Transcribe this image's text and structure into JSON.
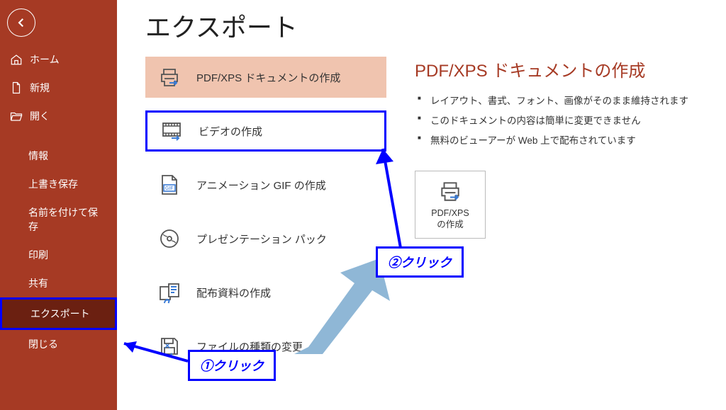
{
  "page_title": "エクスポート",
  "sidebar": {
    "back_label": "戻る",
    "items": [
      {
        "icon": "home",
        "label": "ホーム"
      },
      {
        "icon": "file",
        "label": "新規"
      },
      {
        "icon": "folder",
        "label": "開く"
      }
    ],
    "items2": [
      {
        "label": "情報"
      },
      {
        "label": "上書き保存"
      },
      {
        "label": "名前を付けて保存"
      },
      {
        "label": "印刷"
      },
      {
        "label": "共有"
      },
      {
        "label": "エクスポート",
        "selected": true
      },
      {
        "label": "閉じる"
      }
    ]
  },
  "export_options": [
    {
      "id": "pdfxps",
      "icon": "printer-arrow",
      "label": "PDF/XPS ドキュメントの作成",
      "selected": true
    },
    {
      "id": "video",
      "icon": "film-arrow",
      "label": "ビデオの作成",
      "highlight": true
    },
    {
      "id": "gif",
      "icon": "gif",
      "label": "アニメーション GIF の作成"
    },
    {
      "id": "pack",
      "icon": "disc",
      "label": "プレゼンテーション パック"
    },
    {
      "id": "handout",
      "icon": "handout",
      "label": "配布資料の作成"
    },
    {
      "id": "changetype",
      "icon": "save-edit",
      "label": "ファイルの種類の変更"
    }
  ],
  "detail": {
    "title": "PDF/XPS ドキュメントの作成",
    "bullets": [
      "レイアウト、書式、フォント、画像がそのまま維持されます",
      "このドキュメントの内容は簡単に変更できません",
      "無料のビューアーが Web 上で配布されています"
    ],
    "action_label_line1": "PDF/XPS",
    "action_label_line2": "の作成"
  },
  "annotations": {
    "click1": "①クリック",
    "click2": "②クリック"
  }
}
